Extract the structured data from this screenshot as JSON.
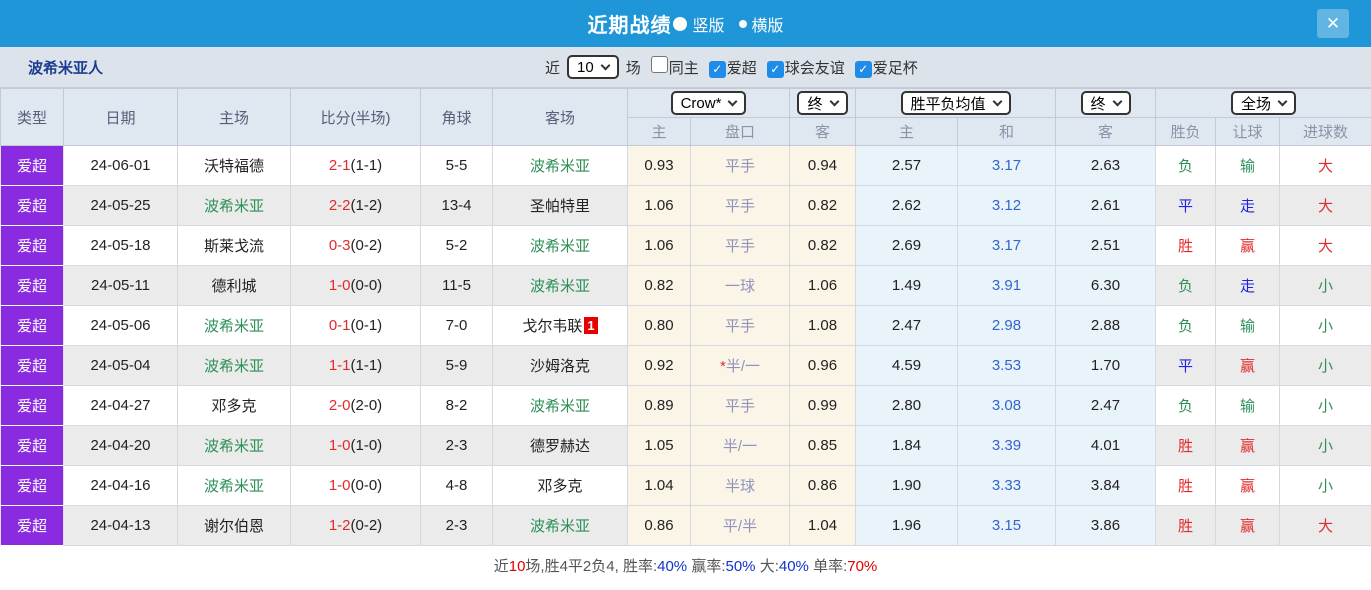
{
  "titlebar": {
    "title": "近期战绩",
    "radio_vertical": "竖版",
    "radio_horizontal": "横版",
    "close": "✕"
  },
  "filterbar": {
    "team": "波希米亚人",
    "recent_label": "近",
    "recent_value": "10",
    "matches_label": "场",
    "checkboxes": [
      {
        "label": "同主",
        "checked": false
      },
      {
        "label": "爱超",
        "checked": true
      },
      {
        "label": "球会友谊",
        "checked": true
      },
      {
        "label": "爱足杯",
        "checked": true
      }
    ]
  },
  "table": {
    "dropdowns": {
      "bookmaker": "Crow*",
      "final1": "终",
      "avg": "胜平负均值",
      "final2": "终",
      "scope": "全场"
    },
    "headers": {
      "type": "类型",
      "date": "日期",
      "home": "主场",
      "score": "比分(半场)",
      "corner": "角球",
      "away": "客场",
      "h_home": "主",
      "h_line": "盘口",
      "h_away": "客",
      "a_home": "主",
      "a_draw": "和",
      "a_away": "客",
      "result": "胜负",
      "handicap_result": "让球",
      "goals": "进球数"
    },
    "rows": [
      {
        "type": "爱超",
        "date": "24-06-01",
        "home": {
          "text": "沃特福德",
          "green": false
        },
        "score": "2-1",
        "half": "(1-1)",
        "corner": "5-5",
        "away": {
          "text": "波希米亚",
          "green": true,
          "badge": ""
        },
        "h1": "0.93",
        "line": {
          "star": false,
          "text": "平手"
        },
        "h2": "0.94",
        "a1": "2.57",
        "a2": "3.17",
        "a3": "2.63",
        "res": {
          "text": "负",
          "color": "green"
        },
        "hres": {
          "text": "输",
          "color": "green"
        },
        "goal": {
          "text": "大",
          "color": "red"
        }
      },
      {
        "type": "爱超",
        "date": "24-05-25",
        "home": {
          "text": "波希米亚",
          "green": true
        },
        "score": "2-2",
        "half": "(1-2)",
        "corner": "13-4",
        "away": {
          "text": "圣帕特里",
          "green": false,
          "badge": ""
        },
        "h1": "1.06",
        "line": {
          "star": false,
          "text": "平手"
        },
        "h2": "0.82",
        "a1": "2.62",
        "a2": "3.12",
        "a3": "2.61",
        "res": {
          "text": "平",
          "color": "blue"
        },
        "hres": {
          "text": "走",
          "color": "blue"
        },
        "goal": {
          "text": "大",
          "color": "red"
        }
      },
      {
        "type": "爱超",
        "date": "24-05-18",
        "home": {
          "text": "斯莱戈流",
          "green": false
        },
        "score": "0-3",
        "half": "(0-2)",
        "corner": "5-2",
        "away": {
          "text": "波希米亚",
          "green": true,
          "badge": ""
        },
        "h1": "1.06",
        "line": {
          "star": false,
          "text": "平手"
        },
        "h2": "0.82",
        "a1": "2.69",
        "a2": "3.17",
        "a3": "2.51",
        "res": {
          "text": "胜",
          "color": "red"
        },
        "hres": {
          "text": "赢",
          "color": "red"
        },
        "goal": {
          "text": "大",
          "color": "red"
        }
      },
      {
        "type": "爱超",
        "date": "24-05-11",
        "home": {
          "text": "德利城",
          "green": false
        },
        "score": "1-0",
        "half": "(0-0)",
        "corner": "11-5",
        "away": {
          "text": "波希米亚",
          "green": true,
          "badge": ""
        },
        "h1": "0.82",
        "line": {
          "star": false,
          "text": "一球"
        },
        "h2": "1.06",
        "a1": "1.49",
        "a2": "3.91",
        "a3": "6.30",
        "res": {
          "text": "负",
          "color": "green"
        },
        "hres": {
          "text": "走",
          "color": "blue"
        },
        "goal": {
          "text": "小",
          "color": "green"
        }
      },
      {
        "type": "爱超",
        "date": "24-05-06",
        "home": {
          "text": "波希米亚",
          "green": true
        },
        "score": "0-1",
        "half": "(0-1)",
        "corner": "7-0",
        "away": {
          "text": "戈尔韦联",
          "green": false,
          "badge": "1"
        },
        "h1": "0.80",
        "line": {
          "star": false,
          "text": "平手"
        },
        "h2": "1.08",
        "a1": "2.47",
        "a2": "2.98",
        "a3": "2.88",
        "res": {
          "text": "负",
          "color": "green"
        },
        "hres": {
          "text": "输",
          "color": "green"
        },
        "goal": {
          "text": "小",
          "color": "green"
        }
      },
      {
        "type": "爱超",
        "date": "24-05-04",
        "home": {
          "text": "波希米亚",
          "green": true
        },
        "score": "1-1",
        "half": "(1-1)",
        "corner": "5-9",
        "away": {
          "text": "沙姆洛克",
          "green": false,
          "badge": ""
        },
        "h1": "0.92",
        "line": {
          "star": true,
          "text": "半/一"
        },
        "h2": "0.96",
        "a1": "4.59",
        "a2": "3.53",
        "a3": "1.70",
        "res": {
          "text": "平",
          "color": "blue"
        },
        "hres": {
          "text": "赢",
          "color": "red"
        },
        "goal": {
          "text": "小",
          "color": "green"
        }
      },
      {
        "type": "爱超",
        "date": "24-04-27",
        "home": {
          "text": "邓多克",
          "green": false
        },
        "score": "2-0",
        "half": "(2-0)",
        "corner": "8-2",
        "away": {
          "text": "波希米亚",
          "green": true,
          "badge": ""
        },
        "h1": "0.89",
        "line": {
          "star": false,
          "text": "平手"
        },
        "h2": "0.99",
        "a1": "2.80",
        "a2": "3.08",
        "a3": "2.47",
        "res": {
          "text": "负",
          "color": "green"
        },
        "hres": {
          "text": "输",
          "color": "green"
        },
        "goal": {
          "text": "小",
          "color": "green"
        }
      },
      {
        "type": "爱超",
        "date": "24-04-20",
        "home": {
          "text": "波希米亚",
          "green": true
        },
        "score": "1-0",
        "half": "(1-0)",
        "corner": "2-3",
        "away": {
          "text": "德罗赫达",
          "green": false,
          "badge": ""
        },
        "h1": "1.05",
        "line": {
          "star": false,
          "text": "半/一"
        },
        "h2": "0.85",
        "a1": "1.84",
        "a2": "3.39",
        "a3": "4.01",
        "res": {
          "text": "胜",
          "color": "red"
        },
        "hres": {
          "text": "赢",
          "color": "red"
        },
        "goal": {
          "text": "小",
          "color": "green"
        }
      },
      {
        "type": "爱超",
        "date": "24-04-16",
        "home": {
          "text": "波希米亚",
          "green": true
        },
        "score": "1-0",
        "half": "(0-0)",
        "corner": "4-8",
        "away": {
          "text": "邓多克",
          "green": false,
          "badge": ""
        },
        "h1": "1.04",
        "line": {
          "star": false,
          "text": "半球"
        },
        "h2": "0.86",
        "a1": "1.90",
        "a2": "3.33",
        "a3": "3.84",
        "res": {
          "text": "胜",
          "color": "red"
        },
        "hres": {
          "text": "赢",
          "color": "red"
        },
        "goal": {
          "text": "小",
          "color": "green"
        }
      },
      {
        "type": "爱超",
        "date": "24-04-13",
        "home": {
          "text": "谢尔伯恩",
          "green": false
        },
        "score": "1-2",
        "half": "(0-2)",
        "corner": "2-3",
        "away": {
          "text": "波希米亚",
          "green": true,
          "badge": ""
        },
        "h1": "0.86",
        "line": {
          "star": false,
          "text": "平/半"
        },
        "h2": "1.04",
        "a1": "1.96",
        "a2": "3.15",
        "a3": "3.86",
        "res": {
          "text": "胜",
          "color": "red"
        },
        "hres": {
          "text": "赢",
          "color": "red"
        },
        "goal": {
          "text": "大",
          "color": "red"
        }
      }
    ]
  },
  "footer": {
    "segments": [
      {
        "text": "近",
        "color": "dark"
      },
      {
        "text": "10",
        "color": "red"
      },
      {
        "text": "场,胜4平2负4, 胜率:",
        "color": "dark"
      },
      {
        "text": "40%",
        "color": "blue"
      },
      {
        "text": " 赢率:",
        "color": "dark"
      },
      {
        "text": "50%",
        "color": "blue"
      },
      {
        "text": " 大:",
        "color": "dark"
      },
      {
        "text": "40%",
        "color": "blue"
      },
      {
        "text": " 单率:",
        "color": "dark"
      },
      {
        "text": "70%",
        "color": "red"
      }
    ]
  }
}
